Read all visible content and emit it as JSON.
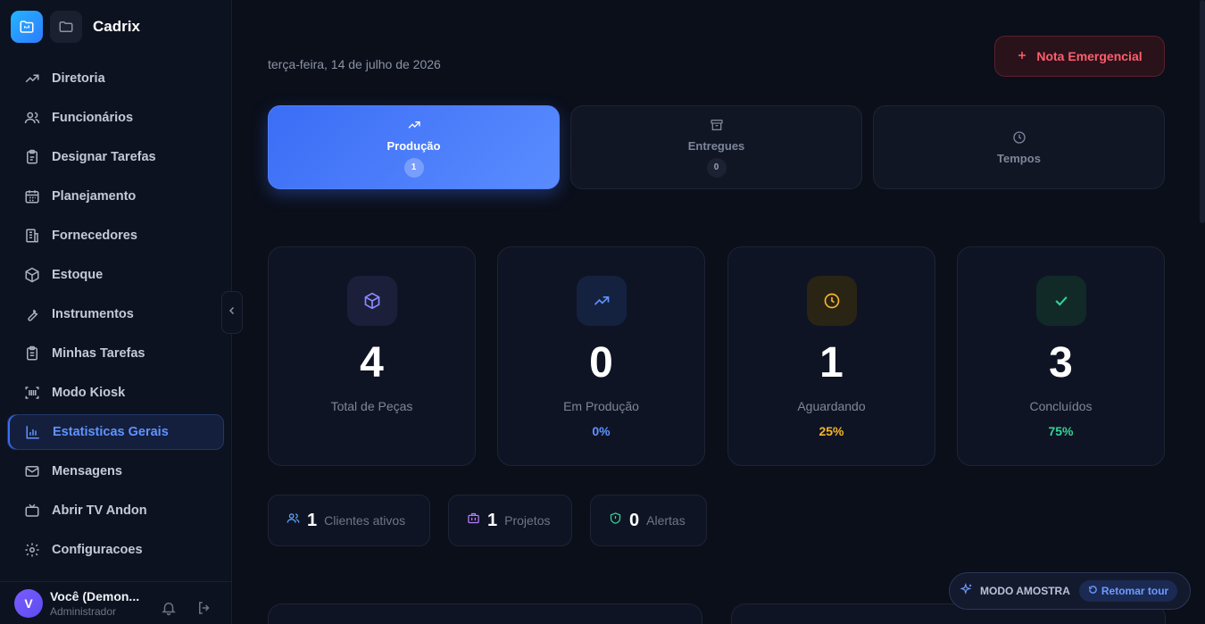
{
  "app": {
    "name": "Cadrix"
  },
  "sidebar": {
    "items": [
      {
        "label": "Diretoria",
        "icon": "trending-up-icon"
      },
      {
        "label": "Funcionários",
        "icon": "users-icon"
      },
      {
        "label": "Designar Tarefas",
        "icon": "clipboard-icon"
      },
      {
        "label": "Planejamento",
        "icon": "calendar-icon"
      },
      {
        "label": "Fornecedores",
        "icon": "building-icon"
      },
      {
        "label": "Estoque",
        "icon": "box-icon"
      },
      {
        "label": "Instrumentos",
        "icon": "wrench-icon"
      },
      {
        "label": "Minhas Tarefas",
        "icon": "clipboard-list-icon"
      },
      {
        "label": "Modo Kiosk",
        "icon": "scan-icon"
      },
      {
        "label": "Estatisticas Gerais",
        "icon": "bar-chart-icon",
        "active": true
      },
      {
        "label": "Mensagens",
        "icon": "mail-icon"
      },
      {
        "label": "Abrir TV Andon",
        "icon": "tv-icon"
      },
      {
        "label": "Configuracoes",
        "icon": "gear-icon"
      }
    ]
  },
  "user": {
    "initial": "V",
    "name": "Você (Demon...",
    "role": "Administrador"
  },
  "header": {
    "date": "terça-feira, 14 de julho de 2026",
    "emergency_label": "Nota Emergencial"
  },
  "tabs": [
    {
      "label": "Produção",
      "count": "1",
      "active": true
    },
    {
      "label": "Entregues",
      "count": "0"
    },
    {
      "label": "Tempos"
    }
  ],
  "stats": [
    {
      "value": "4",
      "label": "Total de Peças",
      "percent": "",
      "color": "#8b8cff",
      "bg": "#1b1f3a"
    },
    {
      "value": "0",
      "label": "Em Produção",
      "percent": "0%",
      "color": "#5f93ff",
      "bg": "#15223f"
    },
    {
      "value": "1",
      "label": "Aguardando",
      "percent": "25%",
      "color": "#f5b629",
      "bg": "#2a2414"
    },
    {
      "value": "3",
      "label": "Concluídos",
      "percent": "75%",
      "color": "#34d399",
      "bg": "#112a28"
    }
  ],
  "chips": [
    {
      "value": "1",
      "label": "Clientes ativos",
      "color": "#5fa8ff"
    },
    {
      "value": "1",
      "label": "Projetos",
      "color": "#b57cff"
    },
    {
      "value": "0",
      "label": "Alertas",
      "color": "#34d399"
    }
  ],
  "sample_mode": {
    "label": "MODO AMOSTRA",
    "resume_label": "Retomar tour"
  },
  "colors": {
    "accent": "#3b6df6",
    "danger": "#ff5f6d",
    "background": "#0b0f1a"
  }
}
